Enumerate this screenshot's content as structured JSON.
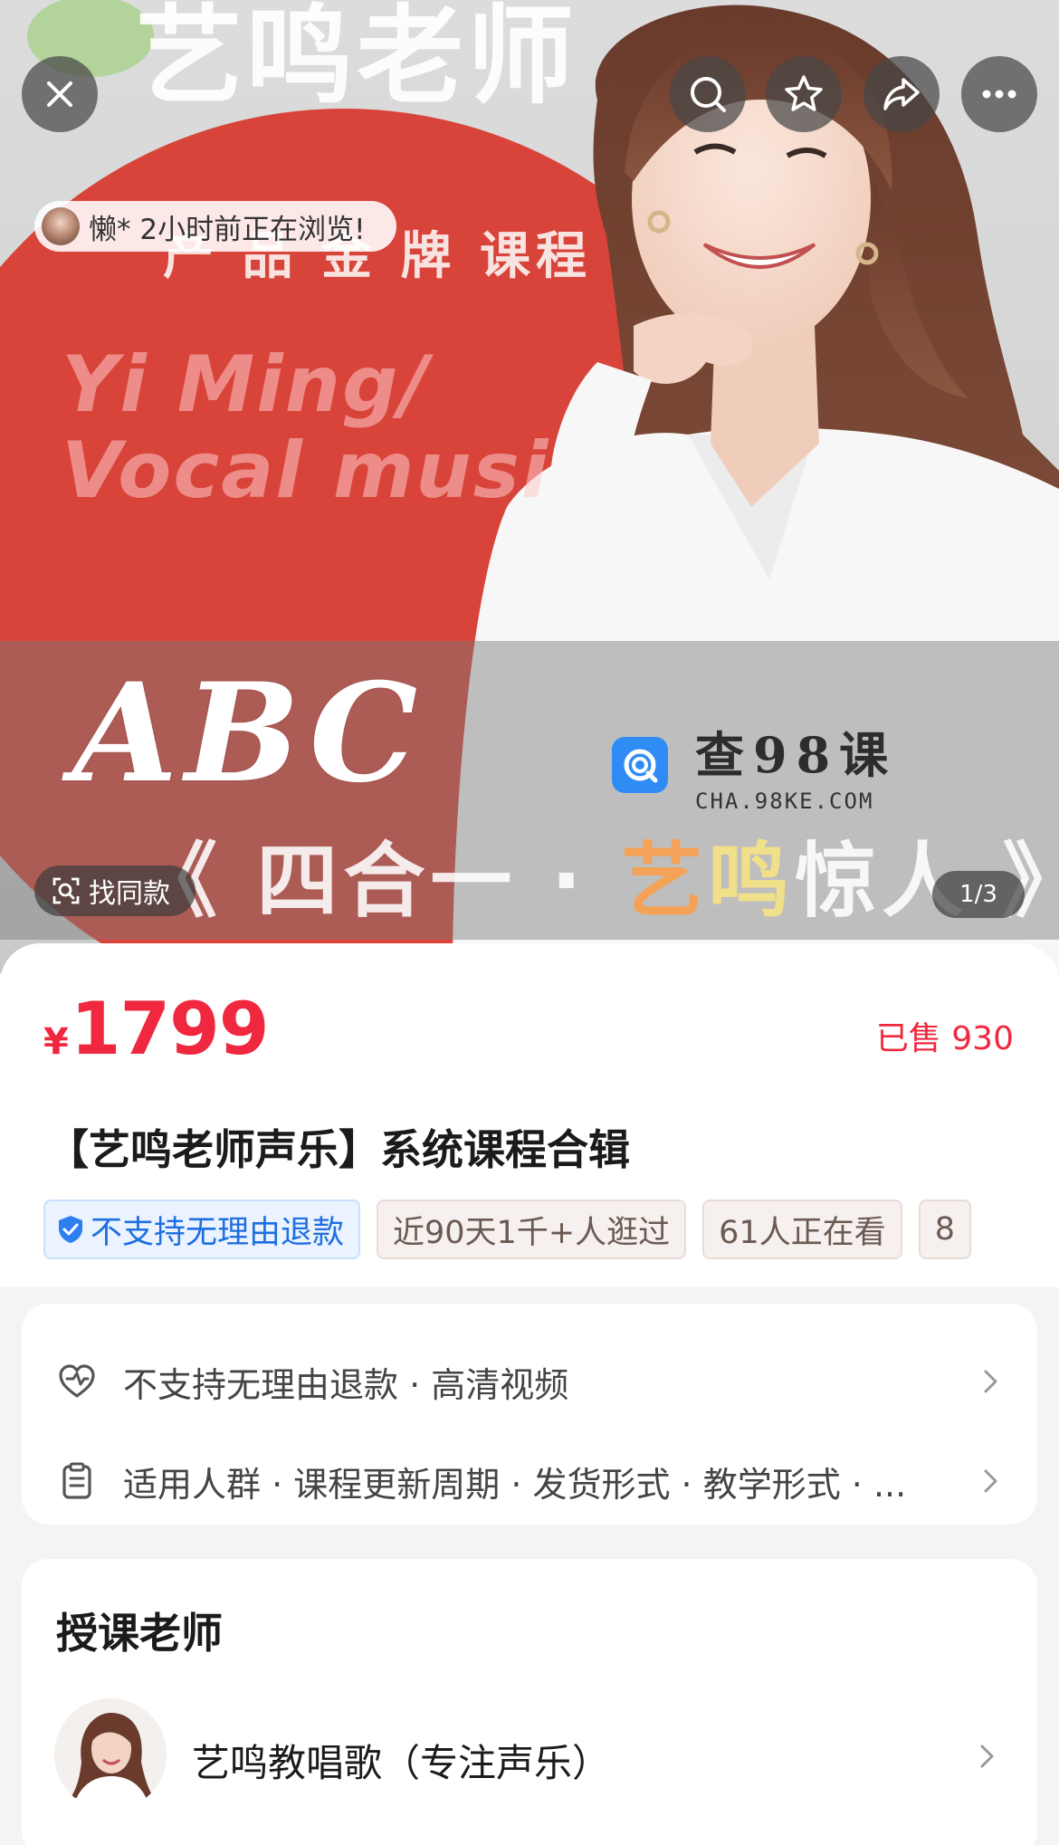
{
  "hero": {
    "poster_title": "艺鸣老师",
    "poster_subtitle": "产 品 金 牌 课程",
    "poster_en_line1": "Yi  Ming/",
    "poster_en_line2": "Vocal musi",
    "poster_abc": "ABC",
    "poster_slogan_prefix": "《 四合一 · ",
    "poster_slogan_hot1": "艺",
    "poster_slogan_hot2": "鸣",
    "poster_slogan_rest": "惊人",
    "poster_slogan_suffix": " 》",
    "watermark_title": "查98课",
    "watermark_url": "CHA.98KE.COM",
    "viewer_text": "懒* 2小时前正在浏览!",
    "find_similar_label": "找同款",
    "page_indicator": "1/3"
  },
  "toolbar": {
    "close_icon": "close-icon",
    "search_icon": "search-icon",
    "favorite_icon": "star-icon",
    "share_icon": "share-icon",
    "more_icon": "more-icon"
  },
  "product": {
    "currency": "¥",
    "price": "1799",
    "sold": "已售 930",
    "title": "【艺鸣老师声乐】系统课程合辑",
    "tags": [
      "不支持无理由退款",
      "近90天1千+人逛过",
      "61人正在看",
      "8"
    ]
  },
  "info": {
    "row1": "不支持无理由退款 · 高清视频",
    "row2": "适用人群 · 课程更新周期 · 发货形式 · 教学形式 · ..."
  },
  "teacher": {
    "heading": "授课老师",
    "name": "艺鸣教唱歌（专注声乐）"
  },
  "colors": {
    "accent_red": "#f0283f",
    "tag_blue": "#1e6fe0",
    "poster_red": "#d8443a"
  }
}
